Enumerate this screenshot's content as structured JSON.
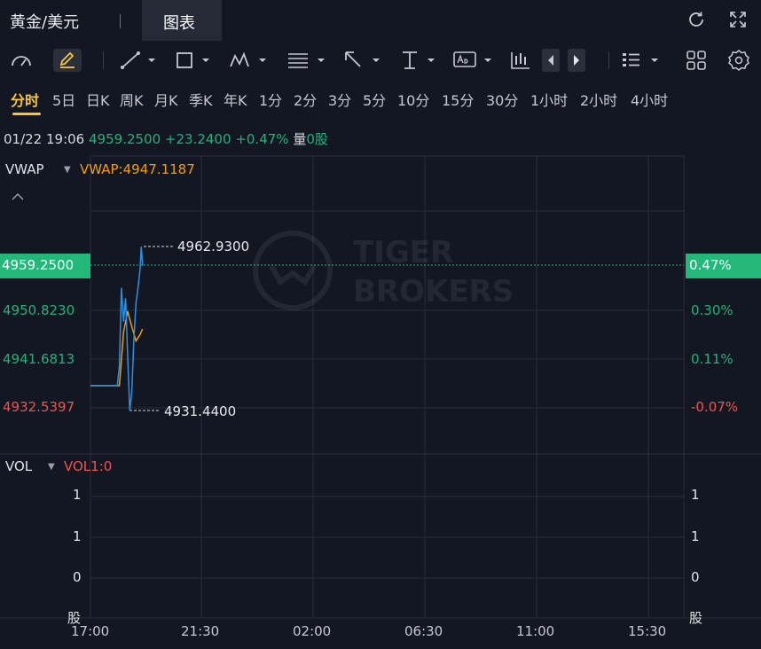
{
  "header": {
    "symbol": "黄金/美元",
    "active_tab": "图表"
  },
  "toolbar": {
    "icons": [
      "gauge-icon",
      "pencil-icon",
      "line-tool-icon",
      "rectangle-tool-icon",
      "wave-pattern-icon",
      "fib-tool-icon",
      "arrow-tool-icon",
      "text-cursor-icon",
      "text-label-icon",
      "candle-type-icon",
      "prev-icon",
      "next-icon",
      "list-layout-icon",
      "grid-layout-icon",
      "gear-icon"
    ]
  },
  "periods": [
    {
      "label": "分时",
      "active": true
    },
    {
      "label": "5日"
    },
    {
      "label": "日K"
    },
    {
      "label": "周K"
    },
    {
      "label": "月K"
    },
    {
      "label": "季K"
    },
    {
      "label": "年K"
    },
    {
      "label": "1分"
    },
    {
      "label": "2分"
    },
    {
      "label": "3分"
    },
    {
      "label": "5分"
    },
    {
      "label": "10分"
    },
    {
      "label": "15分"
    },
    {
      "label": "30分"
    },
    {
      "label": "1小时"
    },
    {
      "label": "2小时"
    },
    {
      "label": "4小时"
    }
  ],
  "quote": {
    "time": "01/22 19:06",
    "price": "4959.2500",
    "change": "+23.2400",
    "change_pct": "+0.47%",
    "volume_label": "量",
    "volume": "0股"
  },
  "main_pane": {
    "indicator": "VWAP",
    "indicator_value": "VWAP:4947.1187",
    "current_price_tag": "4959.2500",
    "current_pct_tag": "0.47%",
    "y_left": [
      "4950.8230",
      "4941.6813",
      "4932.5397"
    ],
    "y_right": [
      "0.30%",
      "0.11%",
      "-0.07%"
    ],
    "high_label": "4962.9300",
    "low_label": "4931.4400",
    "watermark": [
      "TIGER",
      "BROKERS"
    ]
  },
  "vol_pane": {
    "indicator": "VOL",
    "indicator_value": "VOL1:0",
    "y_left": [
      "1",
      "1",
      "0",
      "股"
    ],
    "y_right": [
      "1",
      "1",
      "0",
      "股"
    ]
  },
  "x_axis": [
    "17:00",
    "21:30",
    "02:00",
    "06:30",
    "11:00",
    "15:30"
  ],
  "colors": {
    "background": "#131722",
    "price_line": "#2f8fe0",
    "vwap_line": "#f39c12",
    "up": "#23b77a",
    "down": "#ef5350",
    "active_period": "#f5c53d"
  },
  "chart_data": {
    "type": "line",
    "price_ylim": [
      4931.44,
      4962.93
    ],
    "series": [
      {
        "name": "VWAP",
        "x": [
          "17:00",
          "18:00",
          "18:10",
          "18:20",
          "18:30",
          "18:40",
          "18:50",
          "19:00",
          "19:06"
        ],
        "values": [
          4936.2,
          4936.2,
          4936.2,
          4946.5,
          4950.5,
          4947.5,
          4944.8,
          4946.0,
          4947.1
        ]
      },
      {
        "x": [
          "17:00",
          "18:00",
          "18:05",
          "18:10",
          "18:15",
          "18:20",
          "18:25",
          "18:30",
          "18:35",
          "18:40",
          "18:45",
          "18:50",
          "18:55",
          "19:00",
          "19:03",
          "19:06"
        ],
        "values": [
          4936.2,
          4936.2,
          4936.2,
          4940.0,
          4955.0,
          4948.5,
          4953.0,
          4942.0,
          4931.44,
          4935.0,
          4945.0,
          4952.0,
          4955.0,
          4958.5,
          4962.93,
          4959.25
        ]
      }
    ]
  }
}
